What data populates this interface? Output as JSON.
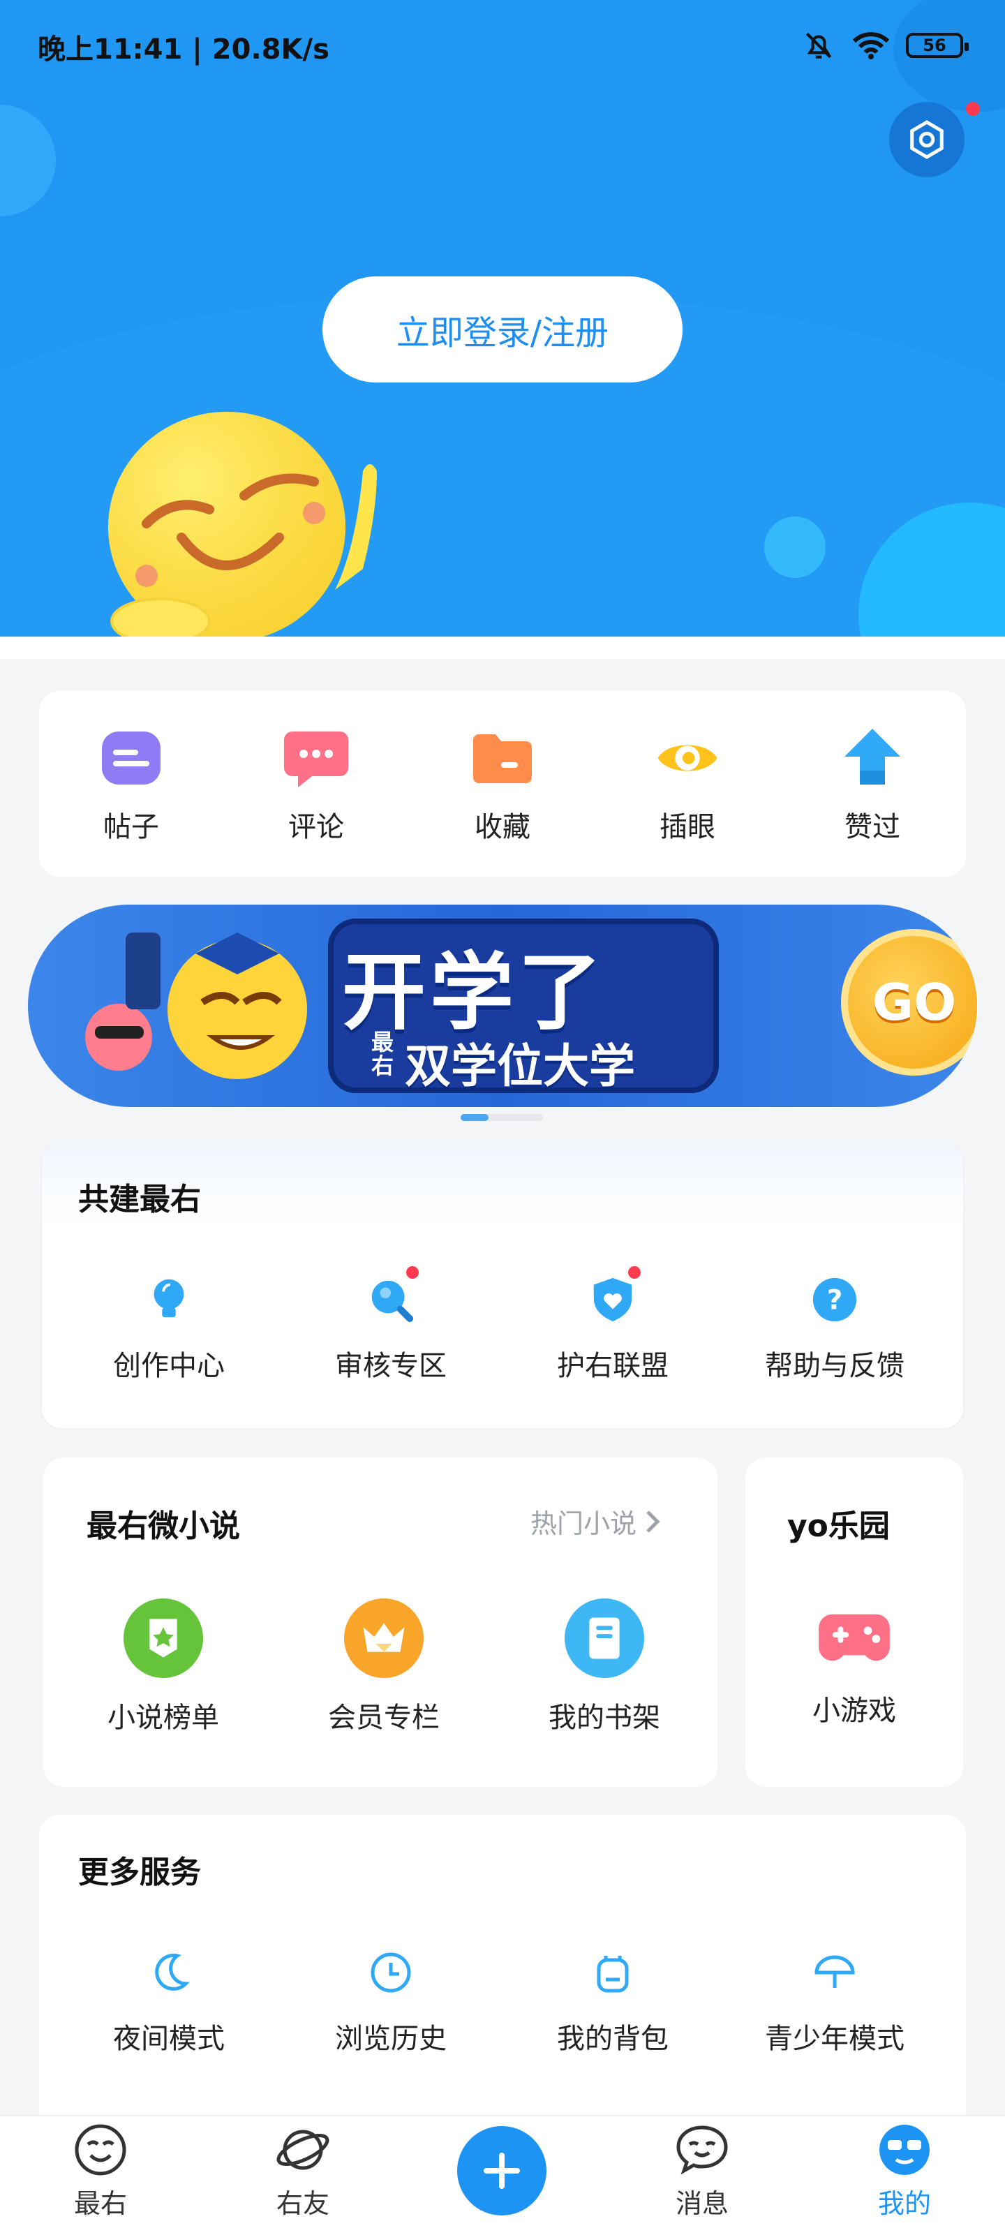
{
  "status_bar": {
    "time_speed": "晚上11:41 | 20.8K/s",
    "battery": "56"
  },
  "header": {
    "login_label": "立即登录/注册"
  },
  "quick_actions": [
    {
      "label": "帖子",
      "icon": "post-icon",
      "color": "#8f7cf5"
    },
    {
      "label": "评论",
      "icon": "comment-icon",
      "color": "#ff6f86"
    },
    {
      "label": "收藏",
      "icon": "folder-icon",
      "color": "#ff8c4a"
    },
    {
      "label": "插眼",
      "icon": "eye-icon",
      "color": "#ffc21a"
    },
    {
      "label": "赞过",
      "icon": "thumb-up-arrow-icon",
      "color": "#2fa8f5"
    }
  ],
  "banner": {
    "title": "开学了",
    "subtitle": "双学位大学",
    "tag": "最右",
    "go": "GO"
  },
  "co_build": {
    "title": "共建最右",
    "items": [
      {
        "label": "创作中心",
        "icon": "lightbulb-icon",
        "dot": false
      },
      {
        "label": "审核专区",
        "icon": "magnifier-icon",
        "dot": true
      },
      {
        "label": "护右联盟",
        "icon": "shield-heart-icon",
        "dot": true
      },
      {
        "label": "帮助与反馈",
        "icon": "question-icon",
        "dot": false
      }
    ]
  },
  "novel": {
    "title": "最右微小说",
    "hot_link": "热门小说",
    "items": [
      {
        "label": "小说榜单",
        "icon": "ranking-badge-icon",
        "color": "#66c43b"
      },
      {
        "label": "会员专栏",
        "icon": "crown-icon",
        "color": "#f8a52a"
      },
      {
        "label": "我的书架",
        "icon": "book-icon",
        "color": "#3fb7f4"
      }
    ]
  },
  "yo_park": {
    "title": "yo乐园",
    "item_label": "小游戏",
    "icon": "gamepad-icon"
  },
  "more_services": {
    "title": "更多服务",
    "items": [
      {
        "label": "夜间模式",
        "icon": "moon-icon"
      },
      {
        "label": "浏览历史",
        "icon": "clock-icon"
      },
      {
        "label": "我的背包",
        "icon": "backpack-icon"
      },
      {
        "label": "青少年模式",
        "icon": "umbrella-icon"
      }
    ]
  },
  "tabbar": {
    "tabs": [
      {
        "label": "最右",
        "icon": "smile-face-icon",
        "active": false
      },
      {
        "label": "右友",
        "icon": "planet-icon",
        "active": false
      },
      {
        "label": "消息",
        "icon": "chat-bubble-icon",
        "active": false
      },
      {
        "label": "我的",
        "icon": "profile-face-icon",
        "active": true
      }
    ],
    "active_color": "#1d93f3"
  }
}
